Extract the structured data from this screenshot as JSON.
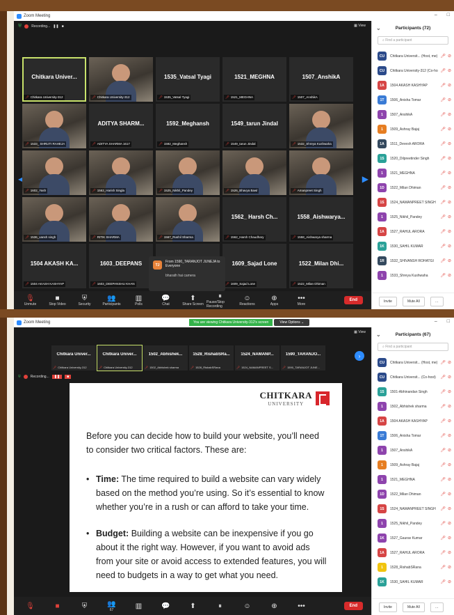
{
  "window1": {
    "title": "Zoom Meeting",
    "recording_label": "Recording...",
    "view_label": "View",
    "gallery": [
      {
        "name": "Chitkara Univer...",
        "caption": "Chitkara University-312",
        "video": false,
        "active": true
      },
      {
        "name": "",
        "caption": "Chitkara University-312",
        "video": true
      },
      {
        "name": "1535_Vatsal Tyagi",
        "caption": "1535_Vatsal Tyagi",
        "video": false
      },
      {
        "name": "1521_MEGHNA",
        "caption": "1521_MEGHNA",
        "video": false
      },
      {
        "name": "1507_AnshikA",
        "caption": "1507_AnshikA",
        "video": false
      },
      {
        "name": "",
        "caption": "1533_ SHRUTI RAHEJA",
        "video": true
      },
      {
        "name": "ADITYA SHARM...",
        "caption": "ADITYA SHARMA 1617",
        "video": false
      },
      {
        "name": "1592_Meghansh",
        "caption": "1592_Meghansh",
        "video": false
      },
      {
        "name": "1549_tarun Jindal",
        "caption": "1549_tarun Jindal",
        "video": false
      },
      {
        "name": "",
        "caption": "1532_Shreya Kushwaha",
        "video": true
      },
      {
        "name": "",
        "caption": "1602_Yash",
        "video": true
      },
      {
        "name": "",
        "caption": "1563_Harish Singla",
        "video": true
      },
      {
        "name": "",
        "caption": "1525_Nikhil_Pandey",
        "video": true
      },
      {
        "name": "",
        "caption": "1526_Bhavya Bawl",
        "video": true
      },
      {
        "name": "",
        "caption": "Amanpreet Singh",
        "video": true
      },
      {
        "name": "",
        "caption": "1536_vansh singh",
        "video": true
      },
      {
        "name": "",
        "caption": "RITIK SHARMA",
        "video": true
      },
      {
        "name": "",
        "caption": "1567_Rushil Sharma",
        "video": true
      },
      {
        "name": "1562_ Harsh Ch...",
        "caption": "1562_Harsh Chaudhary",
        "video": false
      },
      {
        "name": "1558_Aishwarya...",
        "caption": "1558_Aishwarya sharma",
        "video": false
      },
      {
        "name": "1504 AKASH KA...",
        "caption": "1504 AKASH KASHYAP",
        "video": false
      },
      {
        "name": "1603_DEEPANS",
        "caption": "1603_DEEPANSHU KHAN",
        "video": false
      },
      {
        "name": "",
        "caption": "",
        "video": false
      },
      {
        "name": "1609_Sajad Lone",
        "caption": "1609_Sajad Lone",
        "video": false
      },
      {
        "name": "1522_Milan Dhi...",
        "caption": "1522_Milan Dhiman",
        "video": false
      }
    ],
    "chat_popup": {
      "initials": "TJ",
      "from": "From 1590_TARANJOT JUNEJA to Everyone",
      "message": "bharath hai camera"
    },
    "toolbar": {
      "items": [
        {
          "label": "Unmute",
          "icon": "🎙",
          "red": true
        },
        {
          "label": "Stop Video",
          "icon": "■",
          "red": false
        },
        {
          "label": "Security",
          "icon": "⛨",
          "red": false
        },
        {
          "label": "Participants",
          "icon": "👥",
          "red": false
        },
        {
          "label": "Polls",
          "icon": "▥",
          "red": false
        },
        {
          "label": "Chat",
          "icon": "💬",
          "red": false
        },
        {
          "label": "Share Screen",
          "icon": "⬆",
          "red": false
        },
        {
          "label": "Pause/Stop Recording",
          "icon": "⏸",
          "red": false
        },
        {
          "label": "Reactions",
          "icon": "☺",
          "red": false
        },
        {
          "label": "Apps",
          "icon": "⊕",
          "red": false
        },
        {
          "label": "More",
          "icon": "•••",
          "red": false
        }
      ],
      "end_label": "End"
    },
    "participants_panel": {
      "title": "Participants (72)",
      "search_placeholder": "Find a participant",
      "people": [
        {
          "initials": "CU",
          "name": "Chitkara Universit... (Host, me)",
          "color": "#2b4a8a"
        },
        {
          "initials": "CU",
          "name": "Chitkara University-312 (Co-host)",
          "color": "#2b4a8a"
        },
        {
          "initials": "1A",
          "name": "1504 AKASH KASHYAP",
          "color": "#d64545"
        },
        {
          "initials": "1T",
          "name": "1506_Anisha Tomar",
          "color": "#3a7bd5"
        },
        {
          "initials": "1",
          "name": "1507_AnshikA",
          "color": "#8e44ad"
        },
        {
          "initials": "1",
          "name": "1509_Ashray Bajaj",
          "color": "#e67e22"
        },
        {
          "initials": "1A",
          "name": "1511_Devesh ARORA",
          "color": "#34495e"
        },
        {
          "initials": "1S",
          "name": "1520_Dilpreetinder Singh",
          "color": "#2aa198"
        },
        {
          "initials": "1",
          "name": "1521_MEGHNA",
          "color": "#8e44ad"
        },
        {
          "initials": "1D",
          "name": "1522_Milan Dhiman",
          "color": "#8e44ad"
        },
        {
          "initials": "1S",
          "name": "1524_NAMANPREET SINGH",
          "color": "#d64545"
        },
        {
          "initials": "1",
          "name": "1525_Nikhil_Pandey",
          "color": "#8e44ad"
        },
        {
          "initials": "1A",
          "name": "1527_RAHUL ARORA",
          "color": "#d64545"
        },
        {
          "initials": "1K",
          "name": "1530_SAHIL KUMAR",
          "color": "#2aa198"
        },
        {
          "initials": "1R",
          "name": "1532_SHIVANSH ROHATGI",
          "color": "#34495e"
        },
        {
          "initials": "1",
          "name": "1533_Shreya Kushwaha",
          "color": "#8e44ad"
        }
      ],
      "invite_label": "Invite",
      "mute_all_label": "Mute All"
    }
  },
  "window2": {
    "title": "Zoom Meeting",
    "share_banner": "You are viewing Chitkara University-312's screen",
    "view_options": "View Options ⌄",
    "view_label": "View",
    "strip": [
      {
        "name": "Chitkara Univer...",
        "caption": "Chitkara University-312",
        "active": false
      },
      {
        "name": "Chitkara Univer...",
        "caption": "Chitkara University-312",
        "active": true
      },
      {
        "name": "1502_Abhishek...",
        "caption": "1502_Abhishek sharma",
        "active": false
      },
      {
        "name": "1528_RishabSRa...",
        "caption": "1528_RishabSRana",
        "active": false
      },
      {
        "name": "1524_NAMANP...",
        "caption": "1524_NAMANPREET S...",
        "active": false
      },
      {
        "name": "1590_TARANJO...",
        "caption": "1590_TARANJOT JUNE...",
        "active": false
      }
    ],
    "recording_label": "Recording...",
    "slide": {
      "logo_main": "CHITKARA",
      "logo_sub": "UNIVERSITY",
      "intro": "Before you can decide how to build your website, you’ll need to consider two critical factors. These are:",
      "bullet1_head": "Time:",
      "bullet1_text": " The time required to build a website can vary widely based on the method you’re using. So it’s essential to know whether you’re in a rush or can afford to take your time.",
      "bullet2_head": "Budget:",
      "bullet2_text": " Building a website can be inexpensive if you go about it the right way. However, if you want to avoid ads from your site or avoid access to extended features, you will need to budgets in a way to get what you need."
    },
    "toolbar": {
      "items": [
        {
          "label": "",
          "icon": "🎙",
          "red": true
        },
        {
          "label": "",
          "icon": "■",
          "red": true
        },
        {
          "label": "",
          "icon": "⛨",
          "red": false
        },
        {
          "label": "67",
          "icon": "👥",
          "red": false
        },
        {
          "label": "",
          "icon": "▥",
          "red": false
        },
        {
          "label": "",
          "icon": "💬",
          "red": false
        },
        {
          "label": "",
          "icon": "⬆",
          "red": false
        },
        {
          "label": "",
          "icon": "⏸",
          "red": false
        },
        {
          "label": "",
          "icon": "☺",
          "red": false
        },
        {
          "label": "",
          "icon": "⊕",
          "red": false
        },
        {
          "label": "",
          "icon": "•••",
          "red": false
        }
      ],
      "end_label": "End"
    },
    "participants_panel": {
      "title": "Participants (67)",
      "search_placeholder": "Find a participant",
      "people": [
        {
          "initials": "CU",
          "name": "Chitkara Universit... (Host, me)",
          "color": "#2b4a8a"
        },
        {
          "initials": "CU",
          "name": "Chitkara Universit... (Co-host)",
          "color": "#2b4a8a"
        },
        {
          "initials": "1S",
          "name": "1501-Abhinandan Singh",
          "color": "#2aa198"
        },
        {
          "initials": "1",
          "name": "1502_Abhishek sharma",
          "color": "#8e44ad"
        },
        {
          "initials": "1A",
          "name": "1504 AKASH KASHYAP",
          "color": "#d64545"
        },
        {
          "initials": "1T",
          "name": "1506_Anisha Tomar",
          "color": "#3a7bd5"
        },
        {
          "initials": "1",
          "name": "1507_AnshikA",
          "color": "#8e44ad"
        },
        {
          "initials": "1",
          "name": "1509_Ashray Bajaj",
          "color": "#e67e22"
        },
        {
          "initials": "1",
          "name": "1521_MEGHNA",
          "color": "#8e44ad"
        },
        {
          "initials": "1D",
          "name": "1522_Milan Dhiman",
          "color": "#8e44ad"
        },
        {
          "initials": "1S",
          "name": "1524_NAMANPREET SINGH",
          "color": "#d64545"
        },
        {
          "initials": "1",
          "name": "1525_Nikhil_Pandey",
          "color": "#8e44ad"
        },
        {
          "initials": "1K",
          "name": "1527_Gaurav Kumar",
          "color": "#8e44ad"
        },
        {
          "initials": "1A",
          "name": "1527_RAHUL ARORA",
          "color": "#d64545"
        },
        {
          "initials": "1",
          "name": "1528_RishabSRana",
          "color": "#f1c40f"
        },
        {
          "initials": "1K",
          "name": "1530_SAHIL KUMAR",
          "color": "#2aa198"
        }
      ],
      "invite_label": "Invite",
      "mute_all_label": "Mute All"
    }
  }
}
